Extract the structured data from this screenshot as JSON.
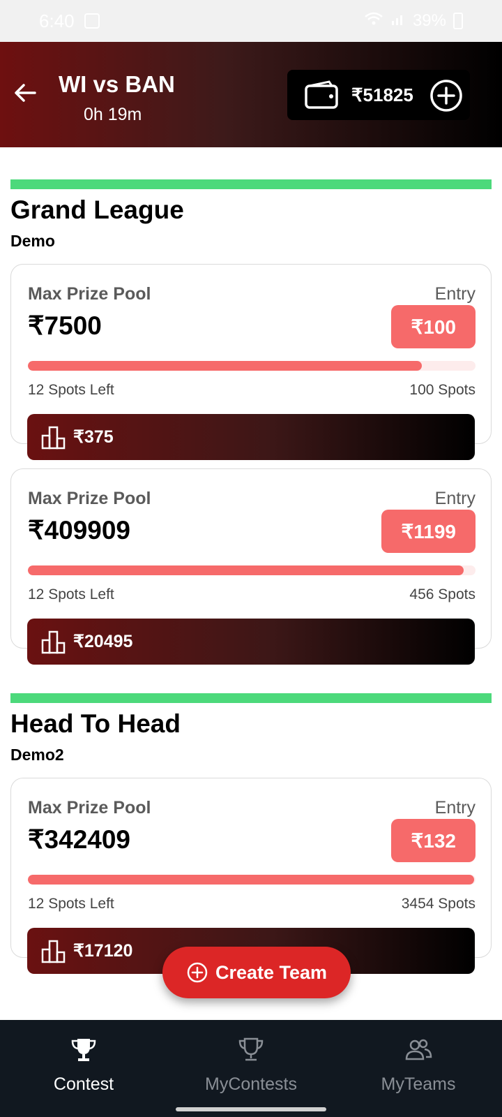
{
  "status_bar": {
    "time": "6:40",
    "battery": "39%"
  },
  "header": {
    "title": "WI vs BAN",
    "time_left": "0h 19m",
    "wallet_amount": "₹51825"
  },
  "sections": [
    {
      "title": "Grand League",
      "subtitle": "Demo",
      "cards": [
        {
          "pool_label": "Max Prize Pool",
          "pool_value": "₹7500",
          "entry_label": "Entry",
          "entry_fee": "₹100",
          "spots_left": "12 Spots Left",
          "spots_total": "100 Spots",
          "fill_fraction": 0.88,
          "first_prize": "₹375"
        },
        {
          "pool_label": "Max Prize Pool",
          "pool_value": "₹409909",
          "entry_label": "Entry",
          "entry_fee": "₹1199",
          "spots_left": "12 Spots Left",
          "spots_total": "456 Spots",
          "fill_fraction": 0.974,
          "first_prize": "₹20495"
        }
      ]
    },
    {
      "title": "Head To Head",
      "subtitle": "Demo2",
      "cards": [
        {
          "pool_label": "Max Prize Pool",
          "pool_value": "₹342409",
          "entry_label": "Entry",
          "entry_fee": "₹132",
          "spots_left": "12 Spots Left",
          "spots_total": "3454 Spots",
          "fill_fraction": 0.997,
          "first_prize": "₹17120"
        }
      ]
    }
  ],
  "fab": {
    "label": "Create Team"
  },
  "nav": {
    "items": [
      {
        "label": "Contest",
        "active": true
      },
      {
        "label": "MyContests",
        "active": false
      },
      {
        "label": "MyTeams",
        "active": false
      }
    ],
    "active_color": "#ffffff",
    "inactive_color": "#8a8f96"
  },
  "colors": {
    "accent_green": "#4cd97b",
    "entry_red": "#f66a6a",
    "fab_red": "#dc2626"
  }
}
